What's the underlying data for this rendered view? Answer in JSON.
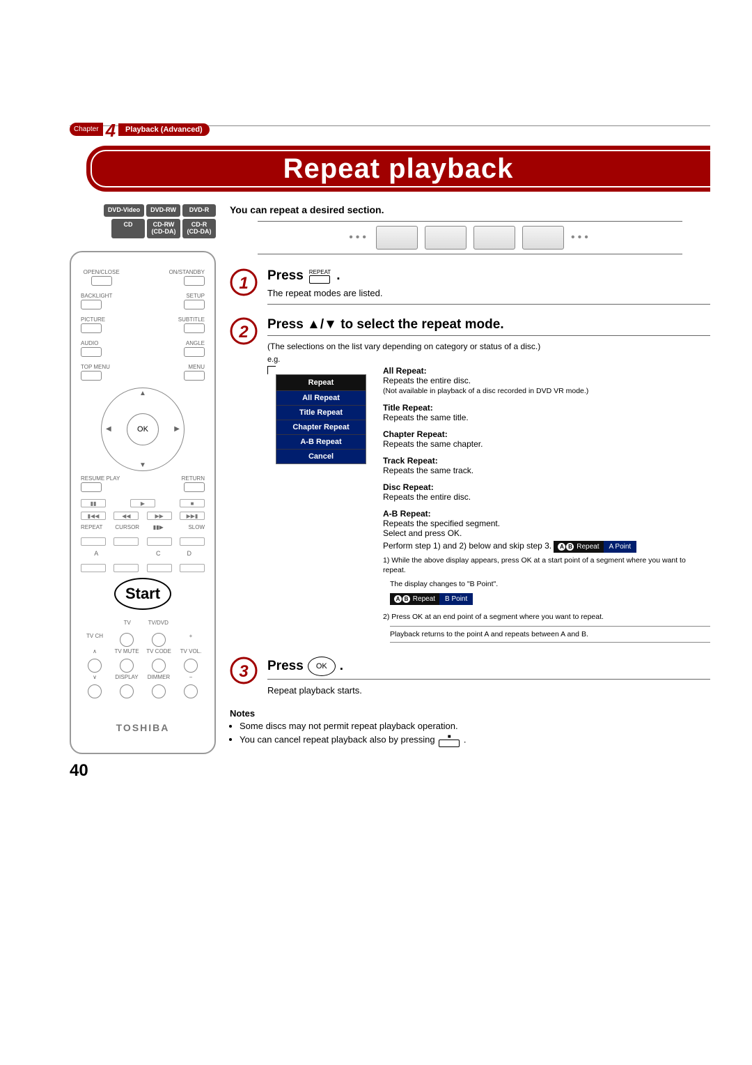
{
  "chapter": {
    "prefix": "Chapter",
    "num": "4",
    "title": "Playback (Advanced)"
  },
  "page_title": "Repeat playback",
  "badges": [
    "DVD-Video",
    "DVD-RW",
    "DVD-R",
    "CD",
    "CD-RW\n(CD-DA)",
    "CD-R\n(CD-DA)"
  ],
  "remote": {
    "row1": [
      "OPEN/CLOSE",
      "ON/STANDBY"
    ],
    "row2": [
      "BACKLIGHT",
      "SETUP"
    ],
    "row3": [
      "PICTURE",
      "SUBTITLE"
    ],
    "row4": [
      "AUDIO",
      "ANGLE"
    ],
    "row5": [
      "TOP MENU",
      "MENU"
    ],
    "ok": "OK",
    "row6": [
      "RESUME PLAY",
      "RETURN"
    ],
    "row7": [
      "REPEAT",
      "CURSOR",
      "",
      "SLOW"
    ],
    "row8": [
      "A",
      "",
      "C",
      "D"
    ],
    "start": "Start",
    "tv_labels": [
      "TV",
      "TV/DVD"
    ],
    "bottom_row1": [
      "TV CH",
      "TV MUTE",
      "TV CODE",
      "+"
    ],
    "bottom_row2": [
      "",
      "DISPLAY",
      "DIMMER",
      "TV VOL."
    ],
    "brand": "TOSHIBA"
  },
  "lead": "You can repeat a desired section.",
  "steps": {
    "s1": {
      "title_a": "Press",
      "title_b": ".",
      "key_label": "REPEAT",
      "sub": "The repeat modes are listed."
    },
    "s2": {
      "title": "Press ▲/▼ to select the repeat mode.",
      "note": "(The selections on the list vary depending on category or status of a disc.)",
      "eg": "e.g.",
      "menu": {
        "header": "Repeat",
        "items": [
          "All Repeat",
          "Title Repeat",
          "Chapter Repeat",
          "A-B Repeat",
          "Cancel"
        ]
      },
      "modes": {
        "all": {
          "h": "All Repeat:",
          "b": "Repeats the entire disc.",
          "n": "(Not available in playback of a disc recorded in DVD VR mode.)"
        },
        "title": {
          "h": "Title Repeat:",
          "b": "Repeats the same title."
        },
        "chapter": {
          "h": "Chapter Repeat:",
          "b": "Repeats the same chapter."
        },
        "track": {
          "h": "Track Repeat:",
          "b": "Repeats the same track."
        },
        "disc": {
          "h": "Disc Repeat:",
          "b": "Repeats the entire disc."
        },
        "ab": {
          "h": "A-B Repeat:",
          "b1": "Repeats the specified segment.",
          "b2": "Select and press OK.",
          "b3": "Perform step 1) and 2) below and skip step 3.",
          "chip1_label": "Repeat",
          "chip1_pt": "A  Point",
          "p1": "1) While the above display appears, press OK at a start point of a segment where you want to repeat.",
          "p1n": "The display changes to \"B Point\".",
          "chip2_label": "Repeat",
          "chip2_pt": "B  Point",
          "p2": "2) Press OK at an end point of a segment where you want to repeat.",
          "p2n": "Playback returns to the point A and repeats between A and B."
        }
      }
    },
    "s3": {
      "title_a": "Press",
      "ok": "OK",
      "title_b": ".",
      "sub": "Repeat playback starts."
    }
  },
  "notes": {
    "h": "Notes",
    "n1": "Some discs may not permit repeat playback operation.",
    "n2a": "You can cancel repeat playback also by pressing",
    "n2b": "."
  },
  "page_num": "40"
}
